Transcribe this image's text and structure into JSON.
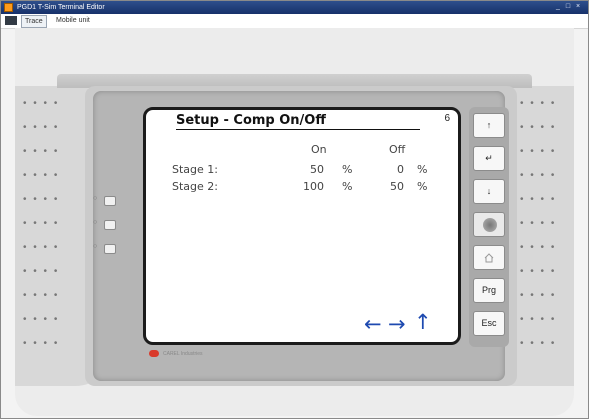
{
  "window": {
    "title": "PGD1 T-Sim Terminal Editor",
    "controls": [
      "_",
      "□",
      "×"
    ]
  },
  "menu": {
    "items": [
      "Trace",
      "Mobile unit"
    ],
    "active_index": 0
  },
  "lcd": {
    "title": "Setup - Comp On/Off",
    "page": "6",
    "header_on": "On",
    "header_off": "Off",
    "rows": [
      {
        "label": "Stage 1:",
        "on_value": "50",
        "on_unit": "%",
        "off_value": "0",
        "off_unit": "%"
      },
      {
        "label": "Stage 2:",
        "on_value": "100",
        "on_unit": "%",
        "off_value": "50",
        "off_unit": "%"
      }
    ],
    "nav": {
      "back": "←",
      "forward": "→",
      "up": "↑"
    }
  },
  "keypad": {
    "up": "↑",
    "enter": "↵",
    "down": "↓",
    "prg": "Prg",
    "esc": "Esc"
  },
  "brand": {
    "text": "CAREL Industries"
  },
  "colors": {
    "nav_arrow": "#1e4ab0",
    "titlebar": "#17316a",
    "logo": "#d93a2b"
  }
}
